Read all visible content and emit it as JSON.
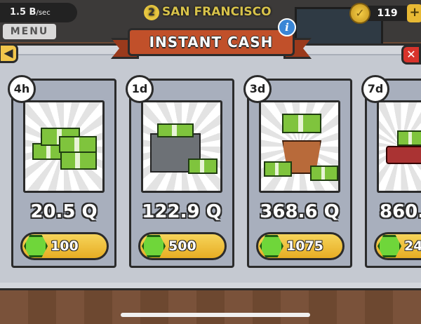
{
  "hud": {
    "income": "1.5 B",
    "income_unit": "/sec",
    "menu_label": "MENU",
    "city_number": "2",
    "city_name": "SAN FRANCISCO",
    "coin_count": "119",
    "coin_plus": "+"
  },
  "dialog": {
    "title": "INSTANT CASH",
    "info_label": "i",
    "back_label": "◀",
    "close_label": "✕"
  },
  "offers": [
    {
      "duration": "4h",
      "amount": "20.5 Q",
      "price": "100"
    },
    {
      "duration": "1d",
      "amount": "122.9 Q",
      "price": "500"
    },
    {
      "duration": "3d",
      "amount": "368.6 Q",
      "price": "1075"
    },
    {
      "duration": "7d",
      "amount": "860.",
      "price": "24"
    }
  ],
  "colors": {
    "banner": "#c1502a",
    "gem": "#6fd63a",
    "buy_button": "#e7ad24",
    "cash": "#7fc43d"
  },
  "icons": {
    "coin": "gold-coin-icon",
    "gem": "green-gem-icon",
    "info": "info-icon",
    "back": "back-arrow-icon",
    "close": "close-icon"
  }
}
